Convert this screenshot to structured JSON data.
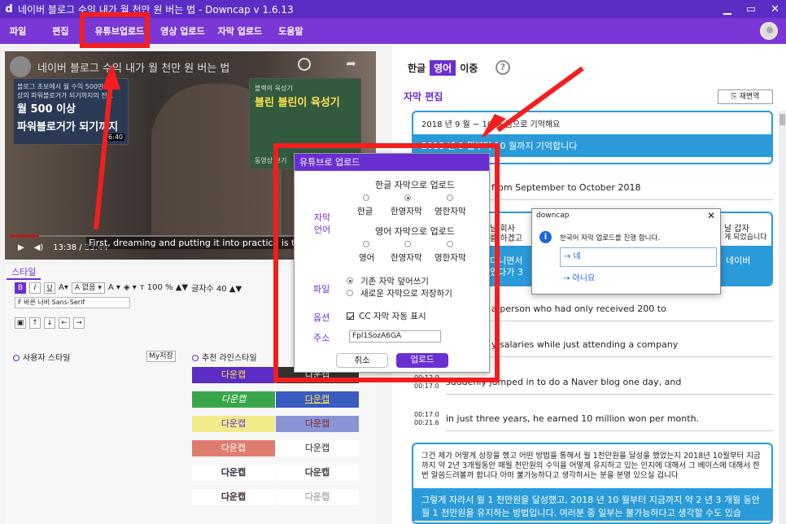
{
  "window": {
    "logo": "d",
    "title": "네이버 블로그 수익 내가 월 천만 원 버는 법 - Downcap v 1.6.13",
    "minimize": "▁",
    "maximize": "▭",
    "close": "✕"
  },
  "menu": [
    "파일",
    "편집",
    "유튜브업로드",
    "영상 업로드",
    "자막 업로드",
    "도움말"
  ],
  "video": {
    "title": "네이버 블로그 수익 내가 월 천만 원 버는 법",
    "thumbA": {
      "line1": "블로그 초보에서 월 수익 500만원 이상의 파워블로거가 되기까지의 전...",
      "line2": "월 500 이상",
      "line3": "파워블로거가 되기까지",
      "duration": "6:40"
    },
    "thumbB": {
      "line1": "블랙의 육성기",
      "line2": "블린 블린이 육성기",
      "line3": "동영상 보기"
    },
    "time": "13:38 / 33:44",
    "subtitle": "First, dreaming and putting it into practice is the first",
    "progress": 0.08
  },
  "style_panel": {
    "tab": "스타일",
    "toolbar1": [
      "B",
      "I",
      "U",
      "A▾",
      "A 없음 ▾",
      "A ▾",
      "◈ ▾",
      "ᴛ 100 % ▲▼",
      "글자수 40 ▲▼"
    ],
    "font_select": "F 바른 너비 Sans-Serif",
    "toolbar2": [
      "▣",
      "↑",
      "↓",
      "←",
      "→"
    ],
    "user_style_label": "사용자 스타일",
    "my_save_btn": "My저장",
    "recommend_label": "추천 라인스타일",
    "styles": [
      [
        "다운캡",
        "다운캡"
      ],
      [
        "다운캡",
        "다운캡"
      ],
      [
        "다운캡",
        "다운캡"
      ],
      [
        "다운캡",
        "다운캡"
      ],
      [
        "다운캡",
        "다운캡"
      ],
      [
        "다운캡",
        "다운캡"
      ]
    ]
  },
  "right_panel": {
    "lang_tabs": [
      "한글",
      "영어",
      "이중"
    ],
    "help": "?",
    "section_title": "자막 편집",
    "redo_btn": "재변역",
    "card1_ko": "2018 년 9 월 ~ 10 월 쯤으로 기억해요",
    "card1_en": "2018 년 9 월부터 10 월까지 기억합니다",
    "line1": "from September to October 2018",
    "card2_ko_a": "날 회사",
    "card2_ko_b": "날 갑자",
    "card2_ko_c": "를 하겠고",
    "card2_ko_d": "게 되었습니다",
    "card2_en_a": "다니면서",
    "card2_en_b": "네이버",
    "card2_en_c": "었다가 3",
    "line2": "a person who had only received 200 to",
    "line3": "y salaries while just attending a company",
    "line4": "suddenly jumped in to do a Naver blog one day, and",
    "tc4a": "00:12.9",
    "tc4b": "00:17.0",
    "line5": "in just three years, he earned 10 million won per month.",
    "tc5a": "00:17.0",
    "tc5b": "00:21.6",
    "bottom_ko": "그건 제가 어떻게 성장을 했고 어떤 방법을 통해서 월 1천만원을 달성을 했었는지 2018년 10월부터 지금까지 약 2년 3개월동안 매월 천만원의 수익을 어떻게 유지하고 있는 인지에 대해서 그 베이스에 대해서 한번 말씀드려볼까 합니다 아마 불가능하다고 생각하시는 분을 분명 있으실 겁니다",
    "bottom_en": "그렇게 자라서 월 1 천만원을 달성했고, 2018 년 10 월부터 지금까지 약 2 년 3 개월 동안 월 1 천만원을 유지하는 방법입니다. 여러분 중 일부는 불가능하다고 생각할 수도 있습"
  },
  "upload_dialog": {
    "title": "유튜브로 업로드",
    "subtitle_label": "자막\n언어",
    "ko_group": "한글 자막으로 업로드",
    "ko_opts": [
      "한글",
      "한영자막",
      "영한자막"
    ],
    "en_group": "영어 자막으로 업로드",
    "en_opts": [
      "영어",
      "한영자막",
      "영한자막"
    ],
    "file_label": "파일",
    "file_opt1": "기존 자막 덮어쓰기",
    "file_opt2": "새로운 자막으로 저장하기",
    "option_label": "옵션",
    "option_cc": "CC 자막 자동 표시",
    "address_label": "주소",
    "address_value": "Fpl1SozA6GA",
    "cancel": "취소",
    "upload": "업로드"
  },
  "confirm_dialog": {
    "title": "downcap",
    "close": "✕",
    "message": "한국어 자막 업로드를 진행 합니다.",
    "yes": "→ 네",
    "no": "→ 아니요"
  },
  "colors": {
    "accent": "#6a2fd0",
    "title_bar": "#5b2dc4",
    "menu_bar": "#7a37d6",
    "card_blue": "#2a9bd8",
    "annotation_red": "#f41e1e"
  }
}
